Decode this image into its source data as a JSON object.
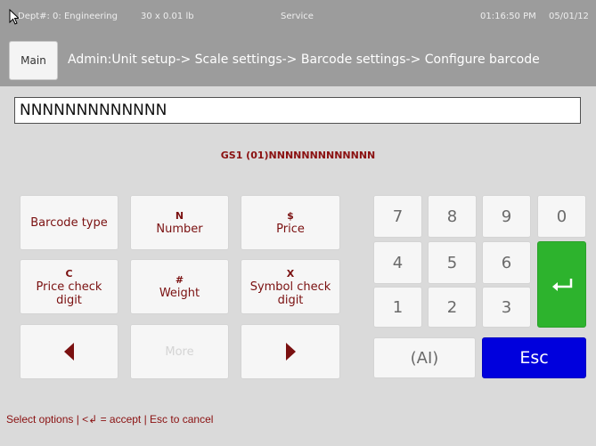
{
  "status": {
    "dept": "Dept#: 0: Engineering",
    "capacity": "30 x 0.01 lb",
    "mode": "Service",
    "time": "01:16:50 PM",
    "date": "05/01/12"
  },
  "header": {
    "main_label": "Main",
    "breadcrumb": "Admin:Unit setup-> Scale settings-> Barcode settings-> Configure barcode"
  },
  "barcode": {
    "value": "NNNNNNNNNNNNN",
    "preview": "GS1 (01)NNNNNNNNNNNNN"
  },
  "function_keys": {
    "barcode_type": "Barcode type",
    "number_symbol": "N",
    "number_label": "Number",
    "price_symbol": "$",
    "price_label": "Price",
    "price_check_symbol": "C",
    "price_check_label": "Price check digit",
    "weight_symbol": "#",
    "weight_label": "Weight",
    "symbol_check_symbol": "X",
    "symbol_check_label": "Symbol check digit",
    "more_label": "More"
  },
  "keypad": {
    "k7": "7",
    "k8": "8",
    "k9": "9",
    "k0": "0",
    "k4": "4",
    "k5": "5",
    "k6": "6",
    "k1": "1",
    "k2": "2",
    "k3": "3",
    "ai_label": "(AI)",
    "esc_label": "Esc"
  },
  "footer": {
    "hint": "Select options | <↲ = accept | Esc to cancel"
  },
  "colors": {
    "status_bar": "#9c9c9c",
    "background": "#dadada",
    "accent_text": "#7a1010",
    "enter_key": "#2db32d",
    "esc_key": "#0000dd"
  }
}
